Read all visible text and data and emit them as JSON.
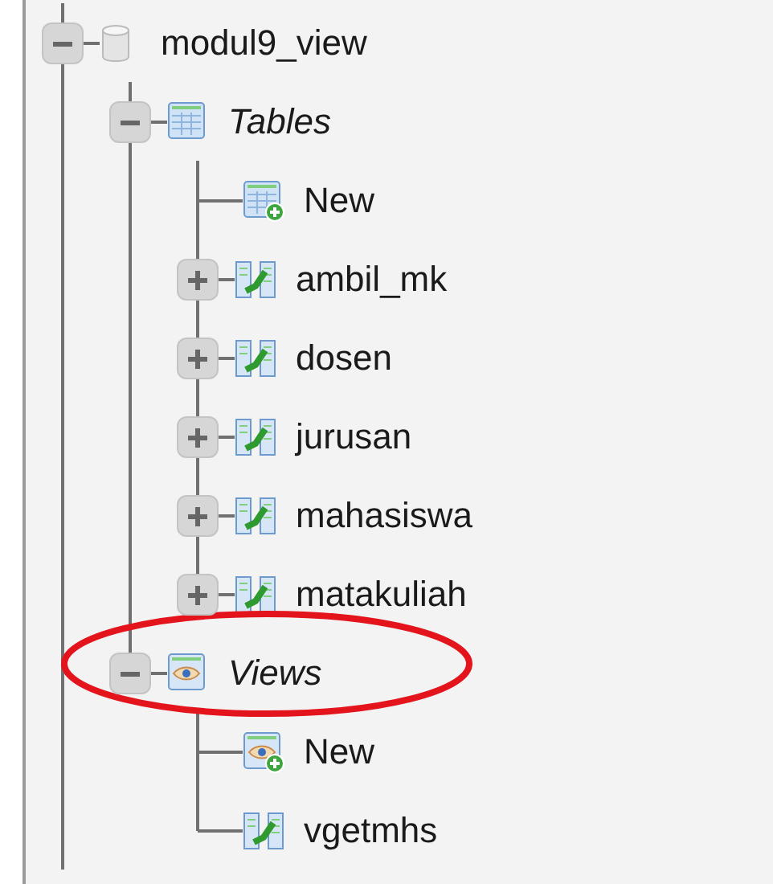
{
  "tree": [
    {
      "label": "modul9_view",
      "kind": "database",
      "expanded": true,
      "children": [
        {
          "label": "Tables",
          "kind": "tables-group",
          "expanded": true,
          "children": [
            {
              "label": "New",
              "kind": "new-table"
            },
            {
              "label": "ambil_mk",
              "kind": "table",
              "expanded": false
            },
            {
              "label": "dosen",
              "kind": "table",
              "expanded": false
            },
            {
              "label": "jurusan",
              "kind": "table",
              "expanded": false
            },
            {
              "label": "mahasiswa",
              "kind": "table",
              "expanded": false
            },
            {
              "label": "matakuliah",
              "kind": "table",
              "expanded": false
            }
          ]
        },
        {
          "label": "Views",
          "kind": "views-group",
          "expanded": true,
          "children": [
            {
              "label": "New",
              "kind": "new-view"
            },
            {
              "label": "vgetmhs",
              "kind": "view"
            }
          ]
        }
      ]
    }
  ],
  "annotation": {
    "kind": "ellipse"
  }
}
